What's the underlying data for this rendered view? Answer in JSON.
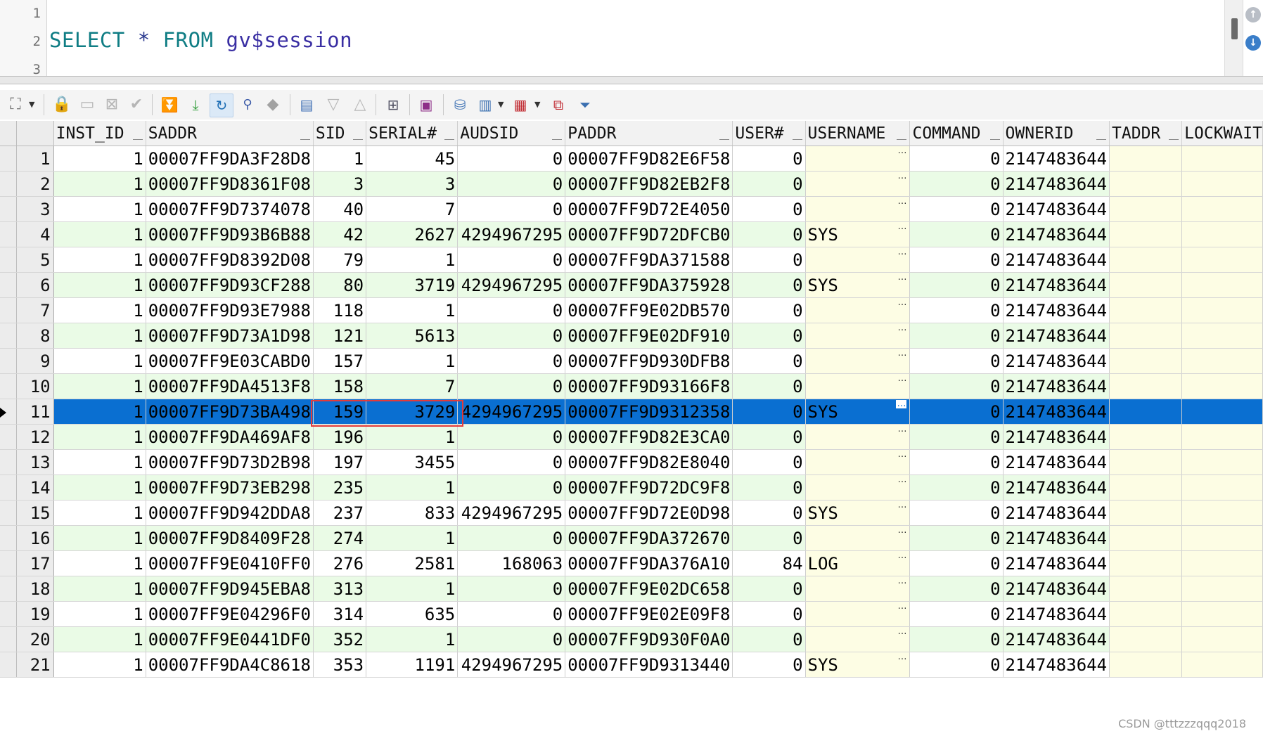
{
  "editor": {
    "line_numbers": [
      "1",
      "2",
      "3"
    ],
    "sql_tokens": {
      "select": "SELECT",
      "star": "*",
      "from": "FROM",
      "table": "gv$session"
    }
  },
  "toolbar": {
    "icons": [
      "grid-select-icon",
      "lock-icon",
      "add-record-icon",
      "delete-record-icon",
      "post-edit-icon",
      "fetch-next-icon",
      "fetch-last-icon",
      "refresh-icon",
      "find-icon",
      "clear-icon",
      "query-by-example-icon",
      "move-down-icon",
      "move-up-icon",
      "connection-tree-icon",
      "save-icon",
      "export-icon",
      "chart-icon",
      "grid-view-icon",
      "compare-icon",
      "filter-icon"
    ]
  },
  "grid": {
    "columns": [
      "INST_ID",
      "SADDR",
      "SID",
      "SERIAL#",
      "AUDSID",
      "PADDR",
      "USER#",
      "USERNAME",
      "COMMAND",
      "OWNERID",
      "TADDR",
      "LOCKWAIT"
    ],
    "selected_row": 11,
    "ellipsis": "…",
    "rows": [
      {
        "n": "1",
        "inst": "1",
        "saddr": "00007FF9DA3F28D8",
        "sid": "1",
        "serial": "45",
        "audsid": "0",
        "paddr": "00007FF9D82E6F58",
        "user": "0",
        "username": "",
        "command": "0",
        "owner": "2147483644"
      },
      {
        "n": "2",
        "inst": "1",
        "saddr": "00007FF9D8361F08",
        "sid": "3",
        "serial": "3",
        "audsid": "0",
        "paddr": "00007FF9D82EB2F8",
        "user": "0",
        "username": "",
        "command": "0",
        "owner": "2147483644"
      },
      {
        "n": "3",
        "inst": "1",
        "saddr": "00007FF9D7374078",
        "sid": "40",
        "serial": "7",
        "audsid": "0",
        "paddr": "00007FF9D72E4050",
        "user": "0",
        "username": "",
        "command": "0",
        "owner": "2147483644"
      },
      {
        "n": "4",
        "inst": "1",
        "saddr": "00007FF9D93B6B88",
        "sid": "42",
        "serial": "2627",
        "audsid": "4294967295",
        "paddr": "00007FF9D72DFCB0",
        "user": "0",
        "username": "SYS",
        "command": "0",
        "owner": "2147483644"
      },
      {
        "n": "5",
        "inst": "1",
        "saddr": "00007FF9D8392D08",
        "sid": "79",
        "serial": "1",
        "audsid": "0",
        "paddr": "00007FF9DA371588",
        "user": "0",
        "username": "",
        "command": "0",
        "owner": "2147483644"
      },
      {
        "n": "6",
        "inst": "1",
        "saddr": "00007FF9D93CF288",
        "sid": "80",
        "serial": "3719",
        "audsid": "4294967295",
        "paddr": "00007FF9DA375928",
        "user": "0",
        "username": "SYS",
        "command": "0",
        "owner": "2147483644"
      },
      {
        "n": "7",
        "inst": "1",
        "saddr": "00007FF9D93E7988",
        "sid": "118",
        "serial": "1",
        "audsid": "0",
        "paddr": "00007FF9E02DB570",
        "user": "0",
        "username": "",
        "command": "0",
        "owner": "2147483644"
      },
      {
        "n": "8",
        "inst": "1",
        "saddr": "00007FF9D73A1D98",
        "sid": "121",
        "serial": "5613",
        "audsid": "0",
        "paddr": "00007FF9E02DF910",
        "user": "0",
        "username": "",
        "command": "0",
        "owner": "2147483644"
      },
      {
        "n": "9",
        "inst": "1",
        "saddr": "00007FF9E03CABD0",
        "sid": "157",
        "serial": "1",
        "audsid": "0",
        "paddr": "00007FF9D930DFB8",
        "user": "0",
        "username": "",
        "command": "0",
        "owner": "2147483644"
      },
      {
        "n": "10",
        "inst": "1",
        "saddr": "00007FF9DA4513F8",
        "sid": "158",
        "serial": "7",
        "audsid": "0",
        "paddr": "00007FF9D93166F8",
        "user": "0",
        "username": "",
        "command": "0",
        "owner": "2147483644"
      },
      {
        "n": "11",
        "inst": "1",
        "saddr": "00007FF9D73BA498",
        "sid": "159",
        "serial": "3729",
        "audsid": "4294967295",
        "paddr": "00007FF9D9312358",
        "user": "0",
        "username": "SYS",
        "command": "0",
        "owner": "2147483644"
      },
      {
        "n": "12",
        "inst": "1",
        "saddr": "00007FF9DA469AF8",
        "sid": "196",
        "serial": "1",
        "audsid": "0",
        "paddr": "00007FF9D82E3CA0",
        "user": "0",
        "username": "",
        "command": "0",
        "owner": "2147483644"
      },
      {
        "n": "13",
        "inst": "1",
        "saddr": "00007FF9D73D2B98",
        "sid": "197",
        "serial": "3455",
        "audsid": "0",
        "paddr": "00007FF9D82E8040",
        "user": "0",
        "username": "",
        "command": "0",
        "owner": "2147483644"
      },
      {
        "n": "14",
        "inst": "1",
        "saddr": "00007FF9D73EB298",
        "sid": "235",
        "serial": "1",
        "audsid": "0",
        "paddr": "00007FF9D72DC9F8",
        "user": "0",
        "username": "",
        "command": "0",
        "owner": "2147483644"
      },
      {
        "n": "15",
        "inst": "1",
        "saddr": "00007FF9D942DDA8",
        "sid": "237",
        "serial": "833",
        "audsid": "4294967295",
        "paddr": "00007FF9D72E0D98",
        "user": "0",
        "username": "SYS",
        "command": "0",
        "owner": "2147483644"
      },
      {
        "n": "16",
        "inst": "1",
        "saddr": "00007FF9D8409F28",
        "sid": "274",
        "serial": "1",
        "audsid": "0",
        "paddr": "00007FF9DA372670",
        "user": "0",
        "username": "",
        "command": "0",
        "owner": "2147483644"
      },
      {
        "n": "17",
        "inst": "1",
        "saddr": "00007FF9E0410FF0",
        "sid": "276",
        "serial": "2581",
        "audsid": "168063",
        "paddr": "00007FF9DA376A10",
        "user": "84",
        "username": "LOG",
        "command": "0",
        "owner": "2147483644"
      },
      {
        "n": "18",
        "inst": "1",
        "saddr": "00007FF9D945EBA8",
        "sid": "313",
        "serial": "1",
        "audsid": "0",
        "paddr": "00007FF9E02DC658",
        "user": "0",
        "username": "",
        "command": "0",
        "owner": "2147483644"
      },
      {
        "n": "19",
        "inst": "1",
        "saddr": "00007FF9E04296F0",
        "sid": "314",
        "serial": "635",
        "audsid": "0",
        "paddr": "00007FF9E02E09F8",
        "user": "0",
        "username": "",
        "command": "0",
        "owner": "2147483644"
      },
      {
        "n": "20",
        "inst": "1",
        "saddr": "00007FF9E0441DF0",
        "sid": "352",
        "serial": "1",
        "audsid": "0",
        "paddr": "00007FF9D930F0A0",
        "user": "0",
        "username": "",
        "command": "0",
        "owner": "2147483644"
      },
      {
        "n": "21",
        "inst": "1",
        "saddr": "00007FF9DA4C8618",
        "sid": "353",
        "serial": "1191",
        "audsid": "4294967295",
        "paddr": "00007FF9D9313440",
        "user": "0",
        "username": "SYS",
        "command": "0",
        "owner": "2147483644"
      }
    ]
  },
  "watermark": "CSDN @tttzzzqqq2018"
}
